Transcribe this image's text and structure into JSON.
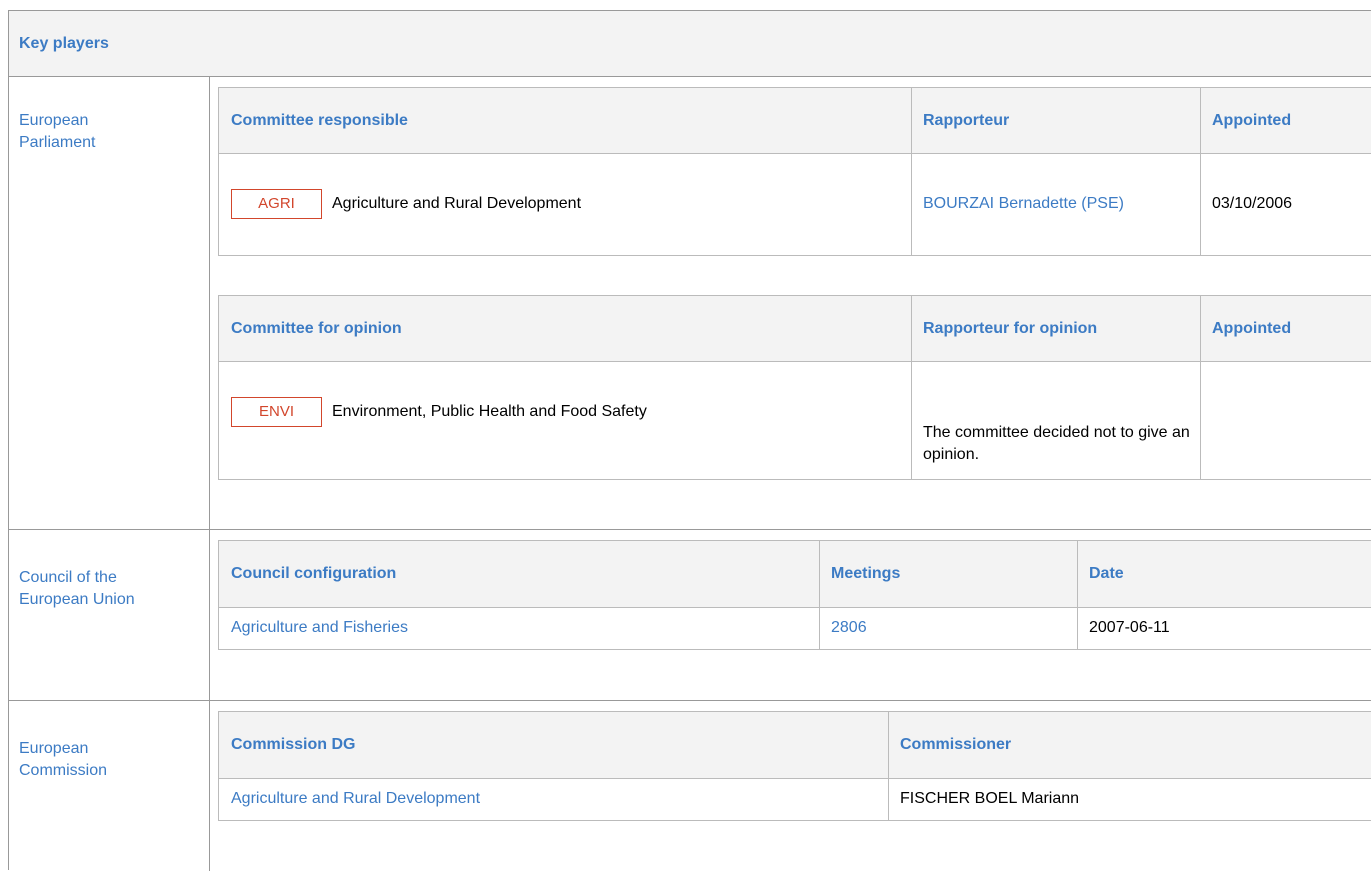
{
  "key_players": {
    "title": "Key players",
    "parliament": {
      "label": "European Parliament",
      "responsible": {
        "headers": [
          "Committee responsible",
          "Rapporteur",
          "Appointed"
        ],
        "row": {
          "tag": "AGRI",
          "committee": "Agriculture and Rural Development",
          "rapporteur": "BOURZAI Bernadette (PSE)",
          "appointed": "03/10/2006"
        }
      },
      "opinion": {
        "headers": [
          "Committee for opinion",
          "Rapporteur for opinion",
          "Appointed"
        ],
        "row": {
          "tag": "ENVI",
          "committee": "Environment, Public Health and Food Safety",
          "rapporteur": "The committee decided not to give an opinion.",
          "appointed": ""
        }
      }
    },
    "council": {
      "label": "Council of the European Union",
      "headers": [
        "Council configuration",
        "Meetings",
        "Date"
      ],
      "row": {
        "configuration": "Agriculture and Fisheries",
        "meetings": "2806",
        "date": "2007-06-11"
      }
    },
    "commission": {
      "label": "European Commission",
      "headers": [
        "Commission DG",
        "Commissioner"
      ],
      "row": {
        "dg": "Agriculture and Rural Development",
        "commissioner": "FISCHER BOEL Mariann"
      }
    }
  },
  "colors": {
    "link": "#3c7bc4",
    "tag": "#d2462c",
    "header_bg": "#f3f3f3",
    "border": "#999999"
  }
}
